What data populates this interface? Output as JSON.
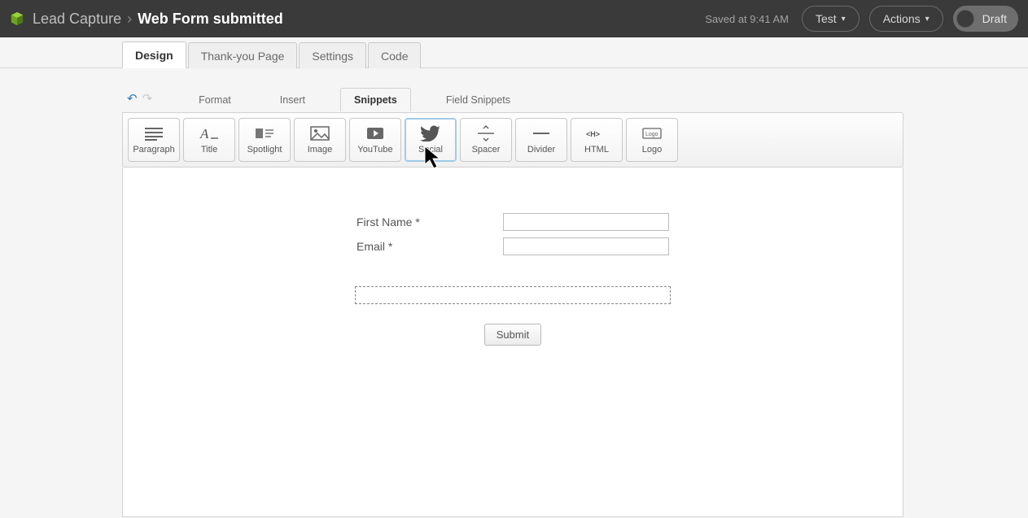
{
  "header": {
    "breadcrumb_parent": "Lead Capture",
    "breadcrumb_sep": "›",
    "breadcrumb_current": "Web Form submitted",
    "saved_text": "Saved at 9:41 AM",
    "test_label": "Test",
    "actions_label": "Actions",
    "draft_label": "Draft"
  },
  "main_tabs": {
    "design": "Design",
    "thank_you": "Thank-you Page",
    "settings": "Settings",
    "code": "Code"
  },
  "tool_tabs": {
    "format": "Format",
    "insert": "Insert",
    "snippets": "Snippets",
    "field_snippets": "Field Snippets"
  },
  "snippets": {
    "paragraph": "Paragraph",
    "title": "Title",
    "spotlight": "Spotlight",
    "image": "Image",
    "youtube": "YouTube",
    "social": "Social",
    "spacer": "Spacer",
    "divider": "Divider",
    "html": "HTML",
    "logo": "Logo"
  },
  "form": {
    "first_name_label": "First Name *",
    "email_label": "Email *",
    "submit_label": "Submit"
  },
  "icons": {
    "cursor": "cursor"
  }
}
